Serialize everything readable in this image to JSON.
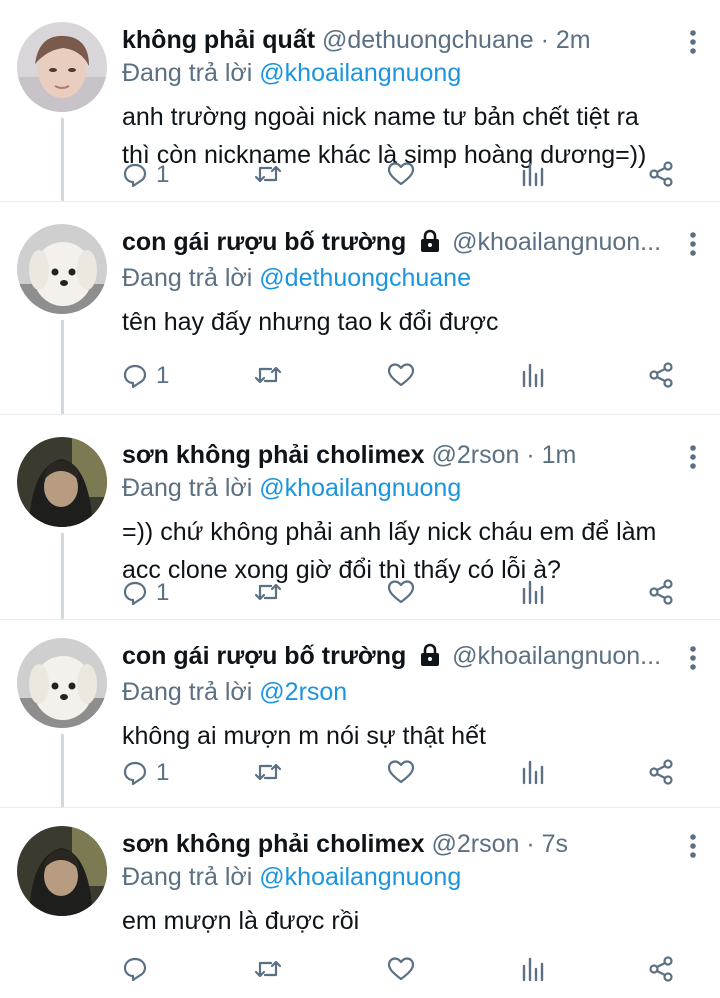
{
  "tweets": [
    {
      "name": "không phải quất",
      "handle": "@dethuongchuane",
      "time": "2m",
      "replying_prefix": "Đang trả lời",
      "replying_to": "@khoailangnuong",
      "text": "anh trường ngoài nick name tư bản chết tiệt ra\nthì còn nickname khác là simp hoàng dương=))",
      "reply_count": "1",
      "avatar": "person-photo",
      "locked": false
    },
    {
      "name": "con gái rượu bố trường",
      "handle": "@khoailangnuon...",
      "time": "",
      "replying_prefix": "Đang trả lời",
      "replying_to": "@dethuongchuane",
      "text": "tên hay đấy nhưng tao k đổi được",
      "reply_count": "1",
      "avatar": "white-dog-photo",
      "locked": true
    },
    {
      "name": "sơn không phải cholimex",
      "handle": "@2rson",
      "time": "1m",
      "replying_prefix": "Đang trả lời",
      "replying_to": "@khoailangnuong",
      "text": "=)) chứ không phải anh lấy nick cháu em để làm\nacc clone xong giờ đổi thì thấy có lỗi à?",
      "reply_count": "1",
      "avatar": "hooded-person-photo",
      "locked": false
    },
    {
      "name": "con gái rượu bố trường",
      "handle": "@khoailangnuon...",
      "time": "",
      "replying_prefix": "Đang trả lời",
      "replying_to": "@2rson",
      "text": "không ai mượn m nói sự thật hết",
      "reply_count": "1",
      "avatar": "white-dog-photo",
      "locked": true
    },
    {
      "name": "sơn không phải cholimex",
      "handle": "@2rson",
      "time": "7s",
      "replying_prefix": "Đang trả lời",
      "replying_to": "@khoailangnuong",
      "text": "em mượn là được rồi",
      "reply_count": "",
      "avatar": "hooded-person-photo",
      "locked": false
    }
  ],
  "separator": "·",
  "colors": {
    "text": "#0f1419",
    "secondary": "#5b7083",
    "mention": "#1b95e0",
    "thread_line": "#cfd9de"
  },
  "icons": [
    "reply-icon",
    "retweet-icon",
    "like-icon",
    "analytics-icon",
    "share-icon",
    "more-icon",
    "lock-icon"
  ]
}
